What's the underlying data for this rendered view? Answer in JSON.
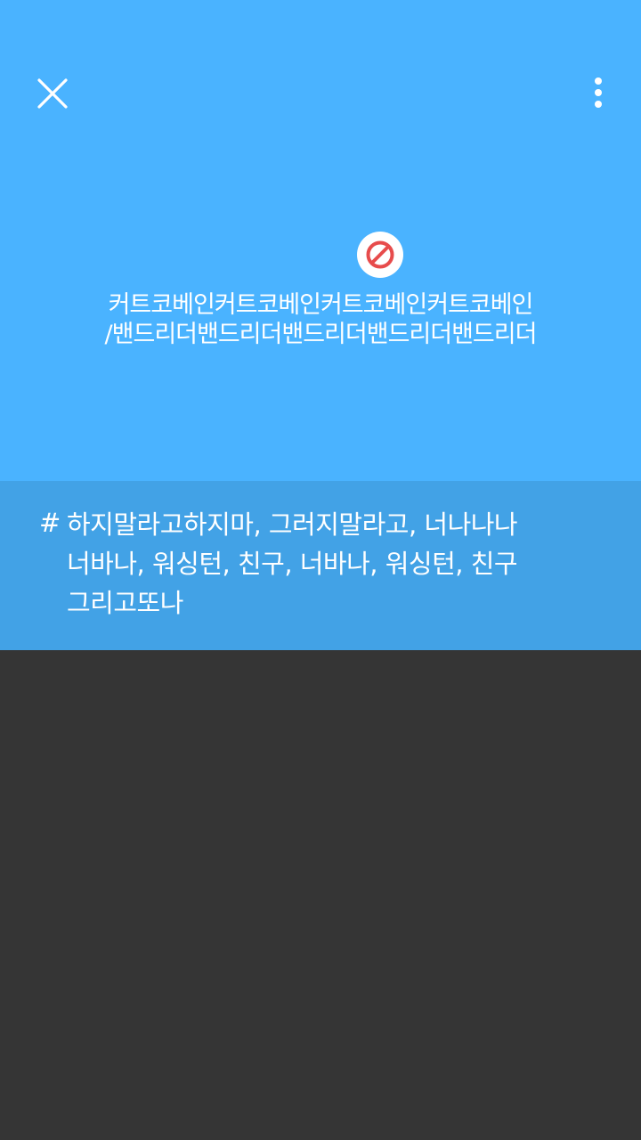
{
  "header": {
    "close_icon": "close-icon",
    "more_icon": "more-vertical-icon"
  },
  "content": {
    "status_icon": "blocked-icon",
    "title_lines": [
      "커트코베인커트코베인커트코베인커트코베인",
      "/밴드리더밴드리더밴드리더밴드리더밴드리더"
    ]
  },
  "tags": {
    "hash": "#",
    "lines": [
      "하지말라고하지마, 그러지말라고, 너나나나",
      "너바나, 워싱턴, 친구, 너바나, 워싱턴, 친구",
      "그리고또나"
    ]
  },
  "colors": {
    "hero_background": "#4ab3ff",
    "tag_background": "#42a2e6",
    "page_background": "#353535",
    "blocked_red": "#e74c4c"
  }
}
